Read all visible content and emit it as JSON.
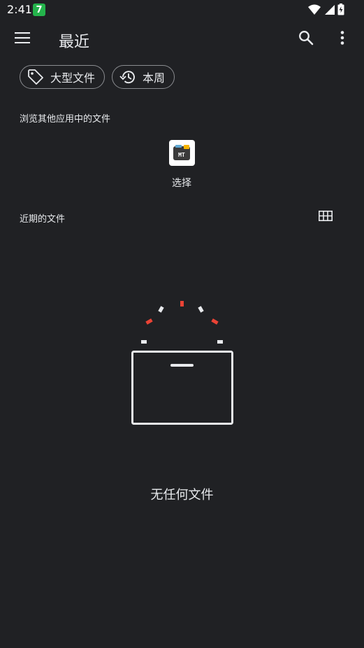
{
  "status_bar": {
    "time": "2:41",
    "notif_badge_text": "7",
    "icons": [
      "wifi-icon",
      "signal-icon",
      "battery-icon"
    ]
  },
  "app_bar": {
    "title": "最近",
    "icons": [
      "menu-icon",
      "search-icon",
      "more-vert-icon"
    ]
  },
  "chips": [
    {
      "label": "大型文件",
      "icon": "tag-icon"
    },
    {
      "label": "本周",
      "icon": "history-icon"
    }
  ],
  "browse": {
    "label": "浏览其他应用中的文件",
    "apps": [
      {
        "label": "选择",
        "icon": "mt-manager-icon",
        "icon_text": "MT"
      }
    ]
  },
  "recent": {
    "label": "近期的文件",
    "view_toggle_icon": "grid-view-icon"
  },
  "empty_state": {
    "text": "无任何文件",
    "illustration": "empty-box-icon"
  },
  "colors": {
    "background": "#202124",
    "text": "#e8eaed",
    "accent_red": "#ea4335",
    "badge_green": "#24b34b"
  }
}
